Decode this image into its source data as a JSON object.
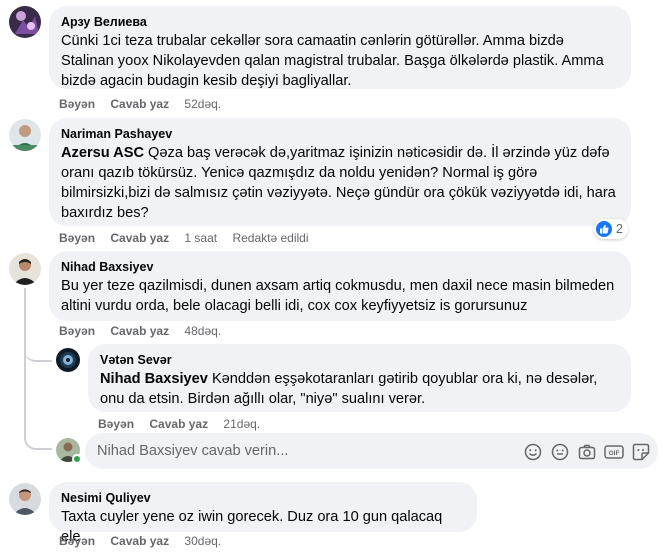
{
  "comments": [
    {
      "author": "Арзу Велиева",
      "text": "Cünki 1ci teza trubalar cekəllər sora camaatin cənlərin götürəllər. Amma bizdə Stalinan yoox Nikolayevden qalan magistral trubalar. Başga ölkələrdə plastik. Amma bizdə agacin budagin kesib deşiyi bagliyallar.",
      "like": "Bəyən",
      "reply": "Cavab yaz",
      "time": "52dəq."
    },
    {
      "author": "Nariman Pashayev",
      "mention": "Azersu ASC",
      "text": " Qəza baş verəcək də,yaritmaz işinizin nəticəsidir də. İl ərzində yüz dəfə oranı qazıb tökürsüz. Yenicə qazmışdız da noldu yenidən? Normal iş görə bilmirsizki,bizi də salmısız çətin vəziyyətə. Neçə gündür ora çökük vəziyyətdə idi, hara baxırdız bes?",
      "like": "Bəyən",
      "reply": "Cavab yaz",
      "time": "1 saat",
      "edited": "Redaktə edildi",
      "reaction_count": "2"
    },
    {
      "author": "Nihad Baxsiyev",
      "text": "Bu yer teze qazilmisdi, dunen axsam artiq cokmusdu, men daxil nece masin bilmeden altini vurdu orda, bele olacagi belli idi, cox cox keyfiyyetsiz is gorursunuz",
      "like": "Bəyən",
      "reply": "Cavab yaz",
      "time": "48dəq."
    },
    {
      "author": "Vətən Sevər",
      "mention": "Nihad Baxsiyev",
      "text": " Kənddən eşşəkotaranları gətirib qoyublar ora ki, nə desələr, onu da etsin. Birdən ağıllı olar, \"niyə\" sualını verər.",
      "like": "Bəyən",
      "reply": "Cavab yaz",
      "time": "21dəq."
    },
    {
      "author": "Nesimi Quliyev",
      "text": "Taxta cuyler yene oz iwin gorecek. Duz ora 10 gun qalacaq ele",
      "like": "Bəyən",
      "reply": "Cavab yaz",
      "time": "30dəq."
    }
  ],
  "reply_box": {
    "placeholder": "Nihad Baxsiyev cavab verin..."
  },
  "icons": [
    "smile-icon",
    "emoji-icon",
    "camera-icon",
    "gif-icon",
    "sticker-icon"
  ]
}
